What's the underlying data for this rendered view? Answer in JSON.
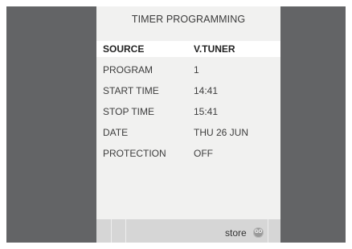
{
  "menu": {
    "title": "TIMER  PROGRAMMING",
    "rows": [
      {
        "label": "SOURCE",
        "value": "V.TUNER",
        "selected": true
      },
      {
        "label": "PROGRAM",
        "value": "1"
      },
      {
        "label": "START TIME",
        "value": "14:41"
      },
      {
        "label": "STOP TIME",
        "value": "15:41"
      },
      {
        "label": "DATE",
        "value": "THU  26 JUN"
      },
      {
        "label": "PROTECTION",
        "value": "OFF"
      }
    ]
  },
  "footer": {
    "store_label": "store",
    "go_icon_text": "GO"
  },
  "colors": {
    "background": "#636466",
    "panel": "#f1f1f0",
    "selected_row": "#ffffff",
    "footer_bar": "#d6d6d6"
  }
}
